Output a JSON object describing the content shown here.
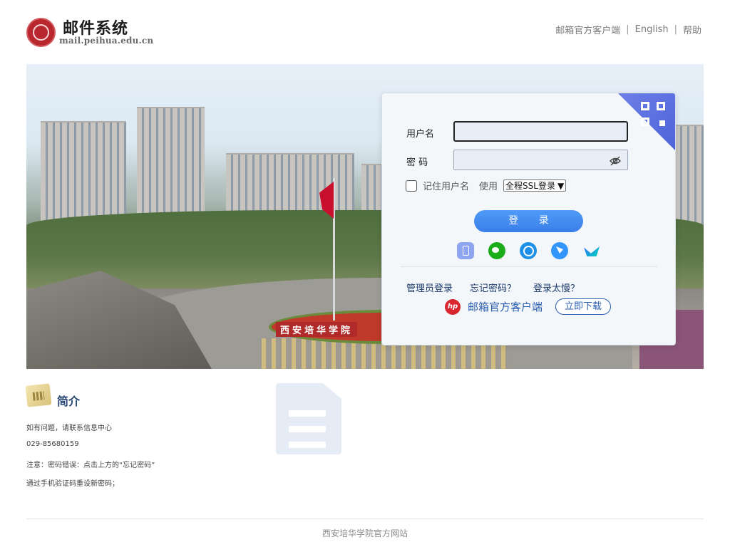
{
  "header": {
    "logo_title": "邮件系统",
    "logo_domain": "mail.peihua.edu.cn",
    "links": [
      "邮箱官方客户端",
      "English",
      "帮助"
    ],
    "separator": "|"
  },
  "login": {
    "username_label": "用户名",
    "username_value": "",
    "password_label": "密 码",
    "password_value": "",
    "remember_label": "记住用户名",
    "use_label": "使用",
    "ssl_option": "全程SSL登录",
    "login_button": "登 录",
    "social_icons": [
      "phone-icon",
      "wechat-icon",
      "chat-icon",
      "dingtalk-icon",
      "lark-icon"
    ],
    "links": [
      "管理员登录",
      "忘记密码？",
      "登录太慢？"
    ],
    "client_logo_text": "hp",
    "client_text": "邮箱官方客户端",
    "download_button": "立即下载"
  },
  "intro": {
    "title": "简介",
    "lines": [
      "如有问题，请联系信息中心",
      "029-85680159",
      "注意：密码错误：点击上方的“忘记密码”",
      "通过手机验证码重设新密码；"
    ]
  },
  "banner": {
    "gate_sign": "西安培华学院"
  },
  "footer": {
    "text": "西安培华学院官方网站"
  },
  "colors": {
    "accent": "#3a7ee9",
    "link": "#1a3a6b",
    "client_link": "#2a5db0",
    "qr_corner": "#5a6fe0"
  }
}
